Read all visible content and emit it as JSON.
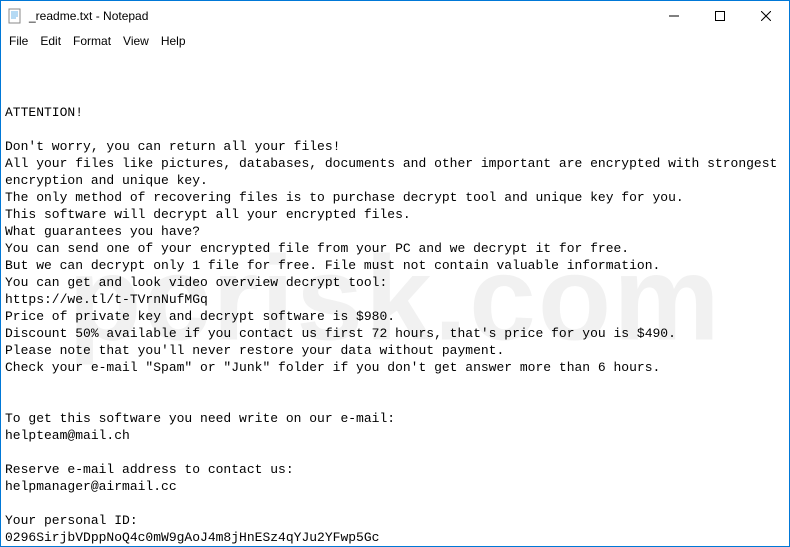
{
  "titlebar": {
    "title": "_readme.txt - Notepad"
  },
  "menubar": {
    "file": "File",
    "edit": "Edit",
    "format": "Format",
    "view": "View",
    "help": "Help"
  },
  "content": {
    "text": "ATTENTION!\n\nDon't worry, you can return all your files!\nAll your files like pictures, databases, documents and other important are encrypted with strongest encryption and unique key.\nThe only method of recovering files is to purchase decrypt tool and unique key for you.\nThis software will decrypt all your encrypted files.\nWhat guarantees you have?\nYou can send one of your encrypted file from your PC and we decrypt it for free.\nBut we can decrypt only 1 file for free. File must not contain valuable information.\nYou can get and look video overview decrypt tool:\nhttps://we.tl/t-TVrnNufMGq\nPrice of private key and decrypt software is $980.\nDiscount 50% available if you contact us first 72 hours, that's price for you is $490.\nPlease note that you'll never restore your data without payment.\nCheck your e-mail \"Spam\" or \"Junk\" folder if you don't get answer more than 6 hours.\n\n\nTo get this software you need write on our e-mail:\nhelpteam@mail.ch\n\nReserve e-mail address to contact us:\nhelpmanager@airmail.cc\n\nYour personal ID:\n0296SirjbVDppNoQ4c0mW9gAoJ4m8jHnESz4qYJu2YFwp5Gc"
  },
  "watermark": "pcrisk.com"
}
